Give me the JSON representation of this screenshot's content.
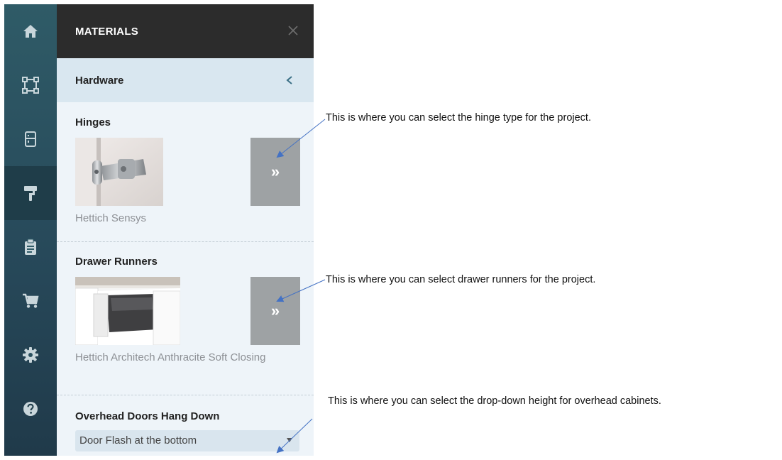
{
  "nav": {
    "items": [
      {
        "icon": "home-icon",
        "active": false
      },
      {
        "icon": "room-layout-icon",
        "active": false
      },
      {
        "icon": "cabinet-icon",
        "active": false
      },
      {
        "icon": "paint-roller-icon",
        "active": true
      },
      {
        "icon": "clipboard-icon",
        "active": false
      },
      {
        "icon": "cart-icon",
        "active": false
      },
      {
        "icon": "gear-icon",
        "active": false
      },
      {
        "icon": "help-icon",
        "active": false
      }
    ]
  },
  "panel": {
    "title": "MATERIALS",
    "close_icon": "close-icon",
    "subsection": "Hardware",
    "back_icon": "chevron-left-icon",
    "hinges": {
      "title": "Hinges",
      "selected": "Hettich Sensys",
      "more_label": "»"
    },
    "drawer_runners": {
      "title": "Drawer Runners",
      "selected": "Hettich Architech Anthracite Soft Closing",
      "more_label": "»"
    },
    "overhead_doors": {
      "title": "Overhead Doors Hang Down",
      "selected": "Door Flash at the bottom"
    }
  },
  "annotations": {
    "hinges": "This is where you can select the hinge type for the project.",
    "drawer_runners": "This is where you can select drawer runners for the project.",
    "overhead_doors": "This is where you can select the drop-down height for overhead cabinets."
  },
  "colors": {
    "rail": "#2f5b67",
    "rail_active": "#1f3d49",
    "panel_bg": "#eef4f9",
    "header_bg": "#2c2c2c",
    "subheader_bg": "#d9e7f0",
    "more_button": "#9ea2a4",
    "arrow": "#4472c4"
  }
}
